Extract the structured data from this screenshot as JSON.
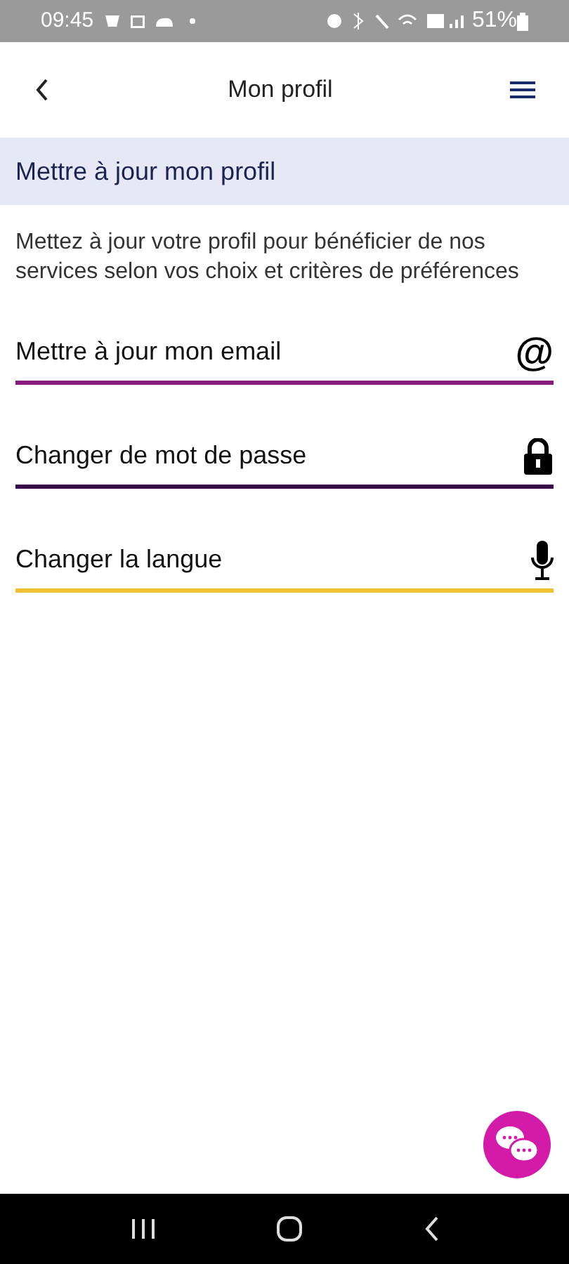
{
  "status_bar": {
    "time": "09:45",
    "battery": "51%"
  },
  "header": {
    "title": "Mon profil"
  },
  "section": {
    "title": "Mettre à jour mon profil",
    "description": "Mettez à jour votre profil pour bénéficier de nos services selon vos choix et critères de préférences"
  },
  "options": [
    {
      "label": "Mettre à jour mon email",
      "kind": "email",
      "icon_text": "@",
      "color": "#8b1a7e"
    },
    {
      "label": "Changer de mot de passe",
      "kind": "password",
      "color": "#3a0a4a"
    },
    {
      "label": "Changer la langue",
      "kind": "language",
      "color": "#f0c030"
    }
  ]
}
